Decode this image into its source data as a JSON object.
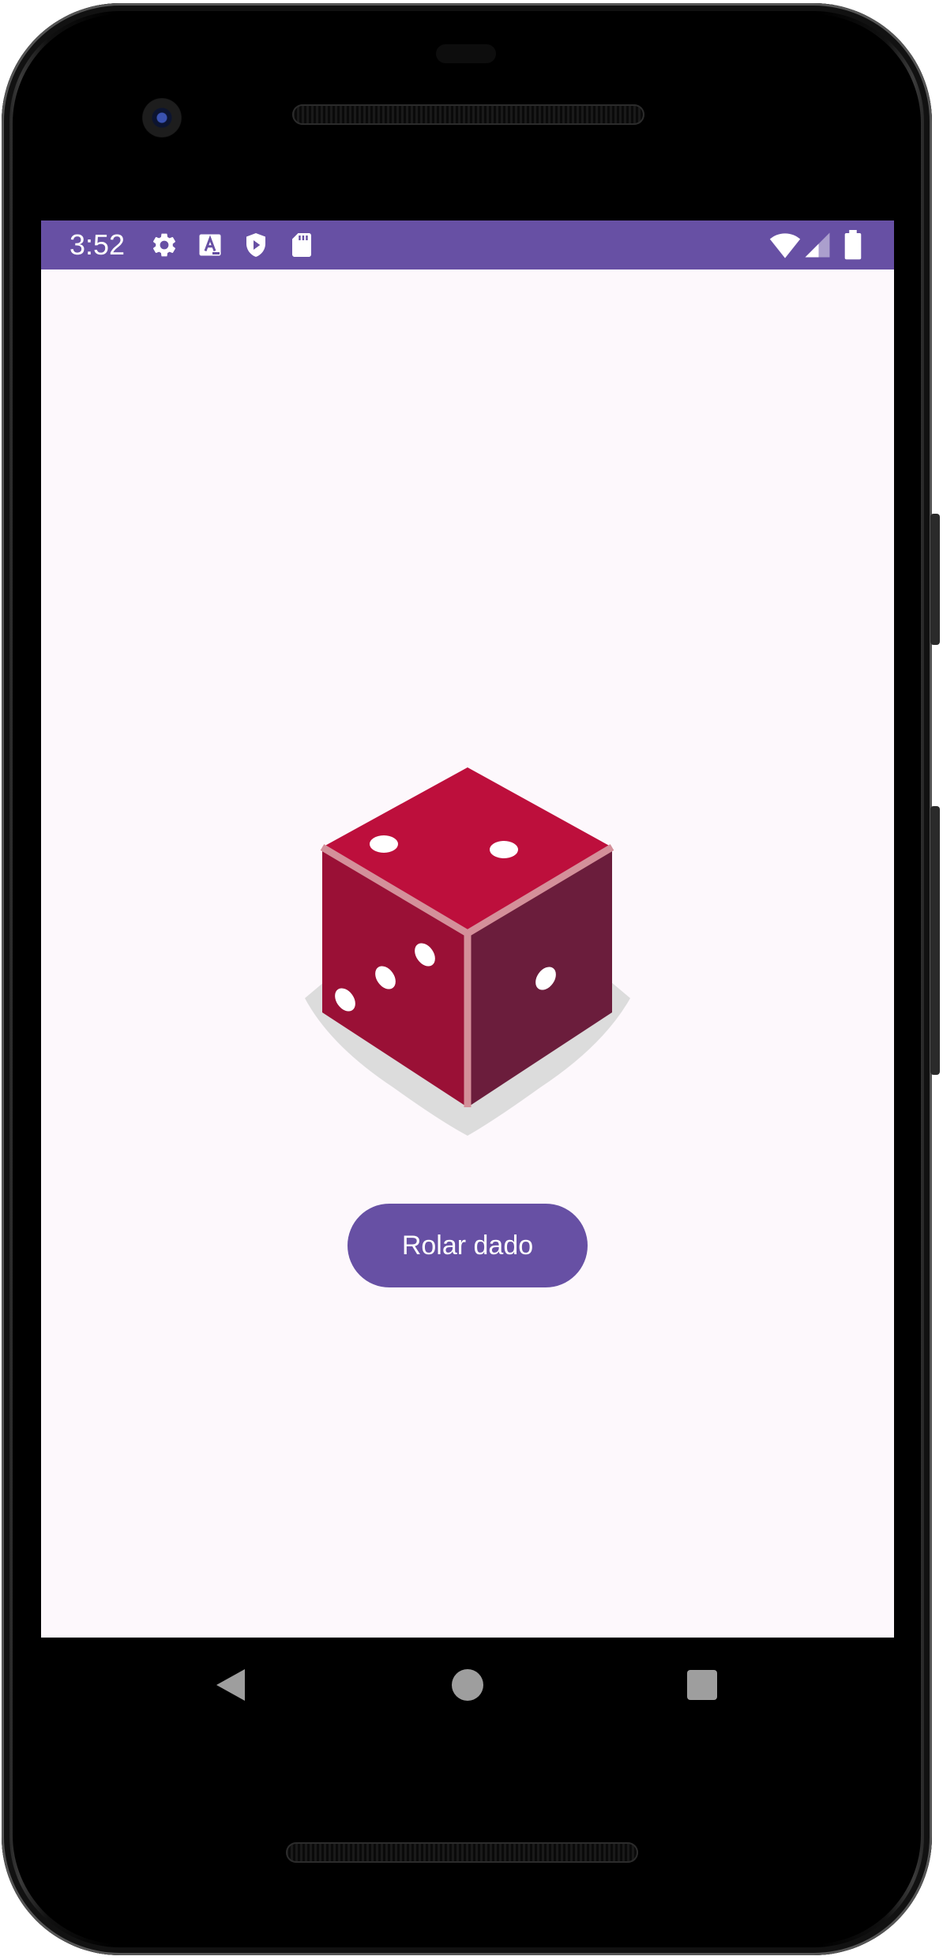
{
  "status_bar": {
    "time": "3:52",
    "background_color": "#6750a4",
    "left_icons": [
      "gear-icon",
      "text-a-icon",
      "shield-play-icon",
      "sd-card-icon"
    ],
    "right_icons": [
      "wifi-icon",
      "cell-signal-icon",
      "battery-icon"
    ]
  },
  "main": {
    "dice_image": {
      "icon": "dice-icon",
      "face_top_pips": 2,
      "face_left_pips": 3,
      "face_right_pips": 1,
      "colors": {
        "top": "#bd0f3c",
        "left": "#9a1036",
        "right": "#6b1d3c",
        "edge": "#d4909a",
        "shadow": "#dcdcdc"
      }
    },
    "roll_button": {
      "label": "Rolar dado",
      "background_color": "#6750a4"
    }
  },
  "navigation_bar": {
    "buttons": [
      "back-icon",
      "home-icon",
      "recents-icon"
    ]
  },
  "theme": {
    "screen_background": "#fdf8fc",
    "accent": "#6750a4"
  }
}
